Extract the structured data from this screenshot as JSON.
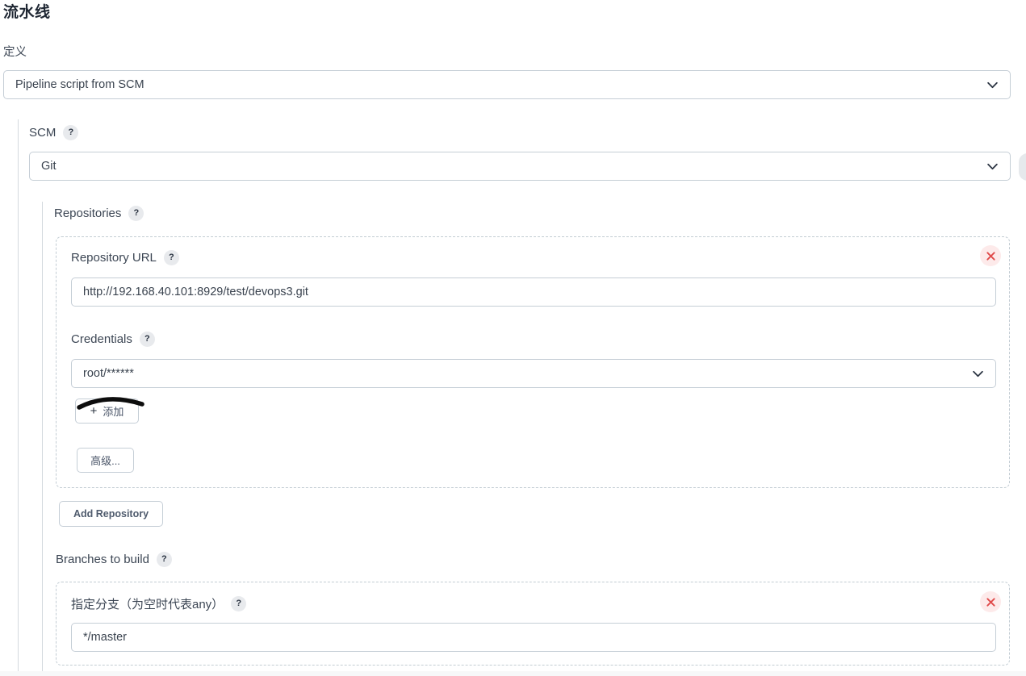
{
  "header": {
    "title": "流水线"
  },
  "definition": {
    "label": "定义",
    "selected": "Pipeline script from SCM",
    "chevron_icon": "chevron-down-icon"
  },
  "scm": {
    "label": "SCM",
    "help_icon": "?",
    "selected": "Git",
    "chevron_icon": "chevron-down-icon"
  },
  "repositories": {
    "label": "Repositories",
    "help_icon": "?",
    "repository_url": {
      "label": "Repository URL",
      "help_icon": "?",
      "value": "http://192.168.40.101:8929/test/devops3.git"
    },
    "credentials": {
      "label": "Credentials",
      "help_icon": "?",
      "value": "root/******",
      "chevron_icon": "chevron-down-icon"
    },
    "add_credentials_button": {
      "label": "添加",
      "plus_icon": "+"
    },
    "advanced_button": {
      "label": "高级..."
    },
    "delete_icon": "close-icon",
    "add_repository_button": {
      "label": "Add Repository"
    }
  },
  "branches": {
    "label": "Branches to build",
    "help_icon": "?",
    "specifier": {
      "label": "指定分支（为空时代表any）",
      "help_icon": "?",
      "value": "*/master"
    },
    "delete_icon": "close-icon"
  },
  "colors": {
    "accent_danger": "#e04a4a",
    "danger_bg": "#fdeaea",
    "border": "#c5ced6",
    "dashed_border": "#c2ccd3",
    "text": "#3c4654",
    "annotation": "#0d0d0d"
  }
}
